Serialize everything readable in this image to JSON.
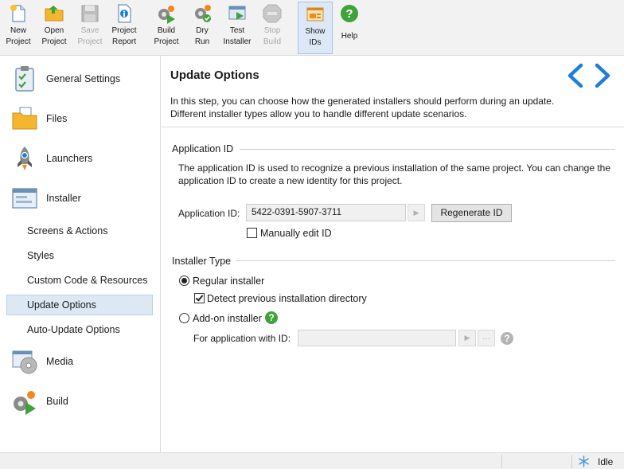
{
  "toolbar": {
    "buttons": [
      {
        "label": "New\nProject",
        "icon": "new-project-icon",
        "enabled": true
      },
      {
        "label": "Open\nProject",
        "icon": "open-folder-icon",
        "enabled": true
      },
      {
        "label": "Save\nProject",
        "icon": "save-disk-icon",
        "enabled": false
      },
      {
        "label": "Project\nReport",
        "icon": "report-icon",
        "enabled": true
      },
      {
        "label": "Build\nProject",
        "icon": "build-gear-icon",
        "enabled": true
      },
      {
        "label": "Dry\nRun",
        "icon": "dry-run-icon",
        "enabled": true
      },
      {
        "label": "Test\nInstaller",
        "icon": "test-installer-icon",
        "enabled": true
      },
      {
        "label": "Stop\nBuild",
        "icon": "stop-icon",
        "enabled": false
      },
      {
        "label": "Show\nIDs",
        "icon": "show-ids-icon",
        "enabled": true,
        "active": true
      },
      {
        "label": "Help",
        "icon": "help-icon",
        "enabled": true
      }
    ]
  },
  "sidebar": {
    "main": [
      {
        "label": "General Settings",
        "icon": "clipboard-check-icon"
      },
      {
        "label": "Files",
        "icon": "folder-files-icon"
      },
      {
        "label": "Launchers",
        "icon": "rocket-icon"
      },
      {
        "label": "Installer",
        "icon": "installer-window-icon"
      },
      {
        "label": "Media",
        "icon": "media-disc-icon"
      },
      {
        "label": "Build",
        "icon": "build-gear-icon"
      }
    ],
    "installer_sub": [
      {
        "label": "Screens & Actions",
        "selected": false
      },
      {
        "label": "Styles",
        "selected": false
      },
      {
        "label": "Custom Code & Resources",
        "selected": false
      },
      {
        "label": "Update Options",
        "selected": true
      },
      {
        "label": "Auto-Update Options",
        "selected": false
      }
    ]
  },
  "main": {
    "title": "Update Options",
    "description_line1": "In this step, you can choose how the generated installers should perform during an update.",
    "description_line2": "Different installer types allow you to handle different update scenarios.",
    "application_id": {
      "heading": "Application ID",
      "desc_line1": "The application ID is used to recognize a previous installation of the same project. You can change the",
      "desc_line2": "application ID to create a new identity for this project.",
      "label": "Application ID:",
      "value": "5422-0391-5907-3711",
      "regenerate_label": "Regenerate ID",
      "manual_edit_label": "Manually edit ID",
      "manual_edit_checked": false
    },
    "installer_type": {
      "heading": "Installer Type",
      "regular_label": "Regular installer",
      "regular_selected": true,
      "detect_label": "Detect previous installation directory",
      "detect_checked": true,
      "addon_label": "Add-on installer",
      "addon_selected": false,
      "for_app_label": "For application with ID:",
      "for_app_value": ""
    }
  },
  "status": {
    "text": "Idle",
    "icon": "snowflake-idle-icon"
  },
  "colors": {
    "accent_blue": "#1e7fd8",
    "selection_bg": "#dde8f5",
    "help_green": "#3fa23a"
  }
}
